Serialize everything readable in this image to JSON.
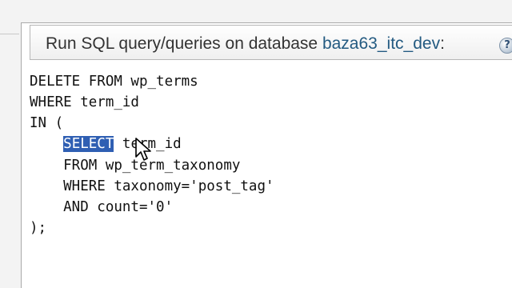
{
  "header": {
    "prefix": "Run SQL query/queries on database ",
    "database": "baza63_itc_dev",
    "suffix": ":"
  },
  "icons": {
    "help": "help-icon",
    "cursor": "mouse-pointer-icon"
  },
  "editor": {
    "lines": [
      "DELETE FROM wp_terms",
      "WHERE term_id",
      "IN (",
      "    SELECT term_id",
      "    FROM wp_term_taxonomy",
      "    WHERE taxonomy='post_tag'",
      "    AND count='0'",
      ");"
    ],
    "selected_text": "SELECT",
    "selected_rest": " term_id"
  },
  "colors": {
    "selection": "#2f5fb3",
    "link": "#235a81"
  }
}
